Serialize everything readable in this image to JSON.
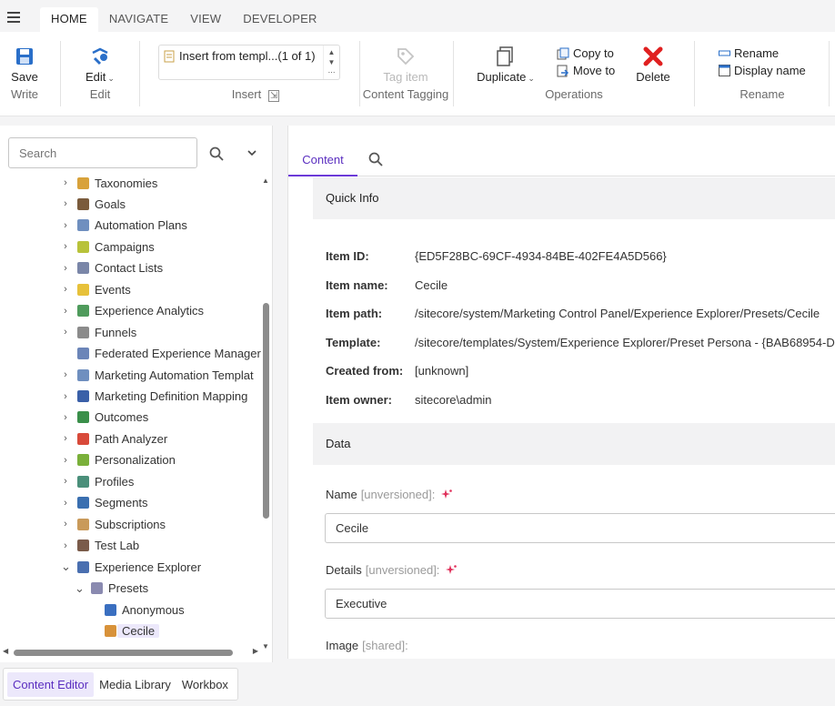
{
  "nav": {
    "tabs": [
      "HOME",
      "NAVIGATE",
      "VIEW",
      "DEVELOPER"
    ],
    "active_tab": "HOME"
  },
  "ribbon": {
    "write": {
      "button": "Save",
      "group": "Write"
    },
    "edit": {
      "button": "Edit",
      "group": "Edit"
    },
    "insert": {
      "option": "Insert from templ...(1 of 1)",
      "group": "Insert"
    },
    "tagging": {
      "button": "Tag item",
      "group": "Content Tagging"
    },
    "operations": {
      "duplicate": "Duplicate",
      "copy_to": "Copy to",
      "move_to": "Move to",
      "delete": "Delete",
      "group": "Operations"
    },
    "rename": {
      "rename": "Rename",
      "display_name": "Display name",
      "group": "Rename"
    }
  },
  "search": {
    "placeholder": "Search"
  },
  "tree": [
    {
      "label": "Taxonomies",
      "icon": "taxonomies-icon",
      "color": "#d8a23a",
      "expandable": true,
      "level": 0
    },
    {
      "label": "Goals",
      "icon": "goals-flag-icon",
      "color": "#7a5b3c",
      "expandable": true,
      "level": 0
    },
    {
      "label": "Automation Plans",
      "icon": "automation-plans-icon",
      "color": "#6f8fbf",
      "expandable": true,
      "level": 0
    },
    {
      "label": "Campaigns",
      "icon": "campaigns-icon",
      "color": "#b8c23a",
      "expandable": true,
      "level": 0
    },
    {
      "label": "Contact Lists",
      "icon": "contact-lists-icon",
      "color": "#7a86a8",
      "expandable": true,
      "level": 0
    },
    {
      "label": "Events",
      "icon": "events-folder-icon",
      "color": "#e7c13a",
      "expandable": true,
      "level": 0
    },
    {
      "label": "Experience Analytics",
      "icon": "experience-analytics-icon",
      "color": "#4f9b5c",
      "expandable": true,
      "level": 0
    },
    {
      "label": "Funnels",
      "icon": "funnels-icon",
      "color": "#8b8b8b",
      "expandable": true,
      "level": 0
    },
    {
      "label": "Federated Experience Manager",
      "icon": "federated-experience-icon",
      "color": "#6b85b8",
      "expandable": false,
      "level": 0
    },
    {
      "label": "Marketing Automation Templat",
      "icon": "automation-templates-icon",
      "color": "#6f8fbf",
      "expandable": true,
      "level": 0
    },
    {
      "label": "Marketing Definition Mapping",
      "icon": "definition-mapping-icon",
      "color": "#3a60a8",
      "expandable": true,
      "level": 0
    },
    {
      "label": "Outcomes",
      "icon": "outcomes-icon",
      "color": "#3a8f4a",
      "expandable": true,
      "level": 0
    },
    {
      "label": "Path Analyzer",
      "icon": "path-analyzer-icon",
      "color": "#d84a3a",
      "expandable": true,
      "level": 0
    },
    {
      "label": "Personalization",
      "icon": "personalization-icon",
      "color": "#7ab03a",
      "expandable": true,
      "level": 0
    },
    {
      "label": "Profiles",
      "icon": "profiles-icon",
      "color": "#4a8f7a",
      "expandable": true,
      "level": 0
    },
    {
      "label": "Segments",
      "icon": "segments-pie-icon",
      "color": "#3a6fb0",
      "expandable": true,
      "level": 0
    },
    {
      "label": "Subscriptions",
      "icon": "subscriptions-icon",
      "color": "#c99a5a",
      "expandable": true,
      "level": 0
    },
    {
      "label": "Test Lab",
      "icon": "test-lab-icon",
      "color": "#7a5b4a",
      "expandable": true,
      "level": 0
    },
    {
      "label": "Experience Explorer",
      "icon": "experience-explorer-icon",
      "color": "#4a6fb0",
      "expandable": true,
      "expanded": true,
      "level": 0
    },
    {
      "label": "Presets",
      "icon": "presets-icon",
      "color": "#8a8ab0",
      "expandable": true,
      "expanded": true,
      "level": 1
    },
    {
      "label": "Anonymous",
      "icon": "persona-anonymous-icon",
      "color": "#3a6fc0",
      "expandable": false,
      "level": 2
    },
    {
      "label": "Cecile",
      "icon": "persona-cecile-icon",
      "color": "#d8923a",
      "expandable": false,
      "level": 2,
      "selected": true
    }
  ],
  "content": {
    "tab": "Content",
    "quick_info": {
      "heading": "Quick Info",
      "rows": [
        {
          "key": "Item ID:",
          "value": "{ED5F28BC-69CF-4934-84BE-402FE4A5D566}"
        },
        {
          "key": "Item name:",
          "value": "Cecile"
        },
        {
          "key": "Item path:",
          "value": "/sitecore/system/Marketing Control Panel/Experience Explorer/Presets/Cecile"
        },
        {
          "key": "Template:",
          "value": "/sitecore/templates/System/Experience Explorer/Preset Persona - {BAB68954-D"
        },
        {
          "key": "Created from:",
          "value": "[unknown]"
        },
        {
          "key": "Item owner:",
          "value": "sitecore\\admin"
        }
      ]
    },
    "data": {
      "heading": "Data",
      "name_label": "Name",
      "name_meta": "[unversioned]:",
      "name_value": "Cecile",
      "details_label": "Details",
      "details_meta": "[unversioned]:",
      "details_value": "Executive",
      "image_label": "Image",
      "image_meta": "[shared]:"
    }
  },
  "bottom_tabs": [
    "Content Editor",
    "Media Library",
    "Workbox"
  ],
  "colors": {
    "accent": "#6c3ad8",
    "selection": "#ece8fb",
    "delete": "#e02020",
    "save": "#2a6fc9"
  }
}
